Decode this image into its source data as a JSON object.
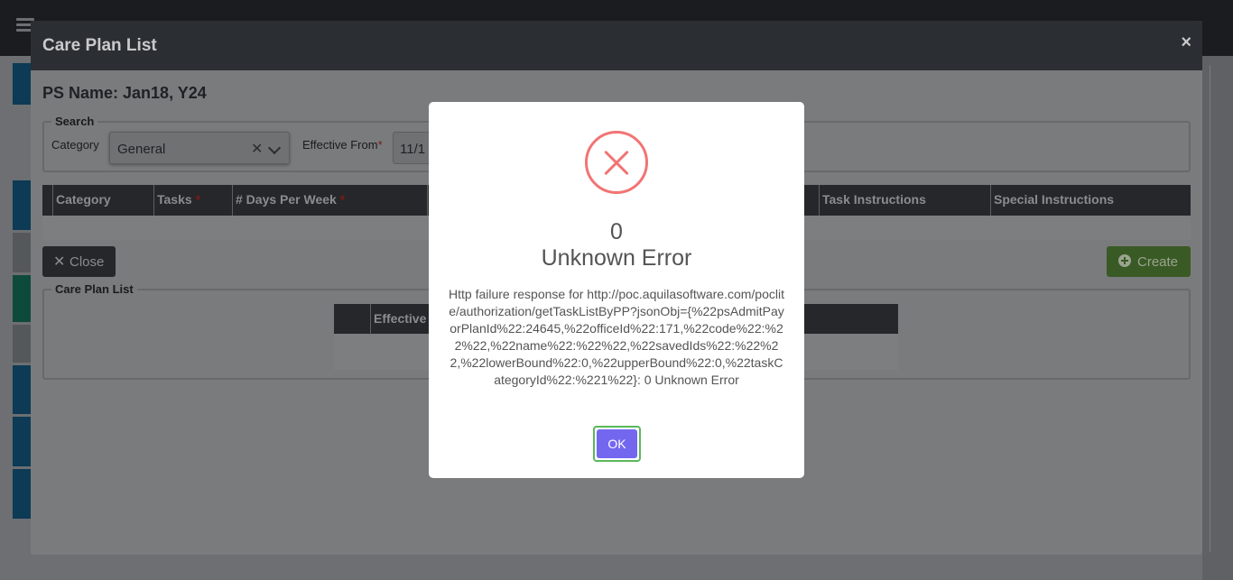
{
  "modal": {
    "title": "Care Plan List",
    "close_symbol": "×",
    "ps_name": "PS Name: Jan18, Y24"
  },
  "search": {
    "legend": "Search",
    "category_label": "Category",
    "category_value": "General",
    "clear_symbol": "✕",
    "effective_from_label": "Effective From",
    "required_mark": "*",
    "effective_from_value": "11/1"
  },
  "tasks_table": {
    "headers": [
      {
        "label": "Category",
        "required": ""
      },
      {
        "label": "Tasks",
        "required": "*"
      },
      {
        "label": "# Days Per Week",
        "required": "*"
      },
      {
        "label": "Task Instructions",
        "required": ""
      },
      {
        "label": "Special Instructions",
        "required": ""
      }
    ]
  },
  "buttons": {
    "close_icon": "✕",
    "close_label": "Close",
    "create_label": "Create"
  },
  "care_plan_list": {
    "legend": "Care Plan List",
    "headers": [
      "Effective"
    ]
  },
  "alert": {
    "code": "0",
    "title": "Unknown Error",
    "message": "Http failure response for http://poc.aquilasoftware.com/poclite/authorization/getTaskListByPP?jsonObj={%22psAdmitPayorPlanId%22:24645,%22officeId%22:171,%22code%22:%22%22,%22name%22:%22%22,%22savedIds%22:%22%22,%22lowerBound%22:0,%22upperBound%22:0,%22taskCategoryId%22:%221%22}: 0 Unknown Error",
    "ok_label": "OK"
  },
  "colors": {
    "error_red": "#f27474",
    "ok_purple": "#7367f0",
    "create_green": "#6aa84f"
  }
}
